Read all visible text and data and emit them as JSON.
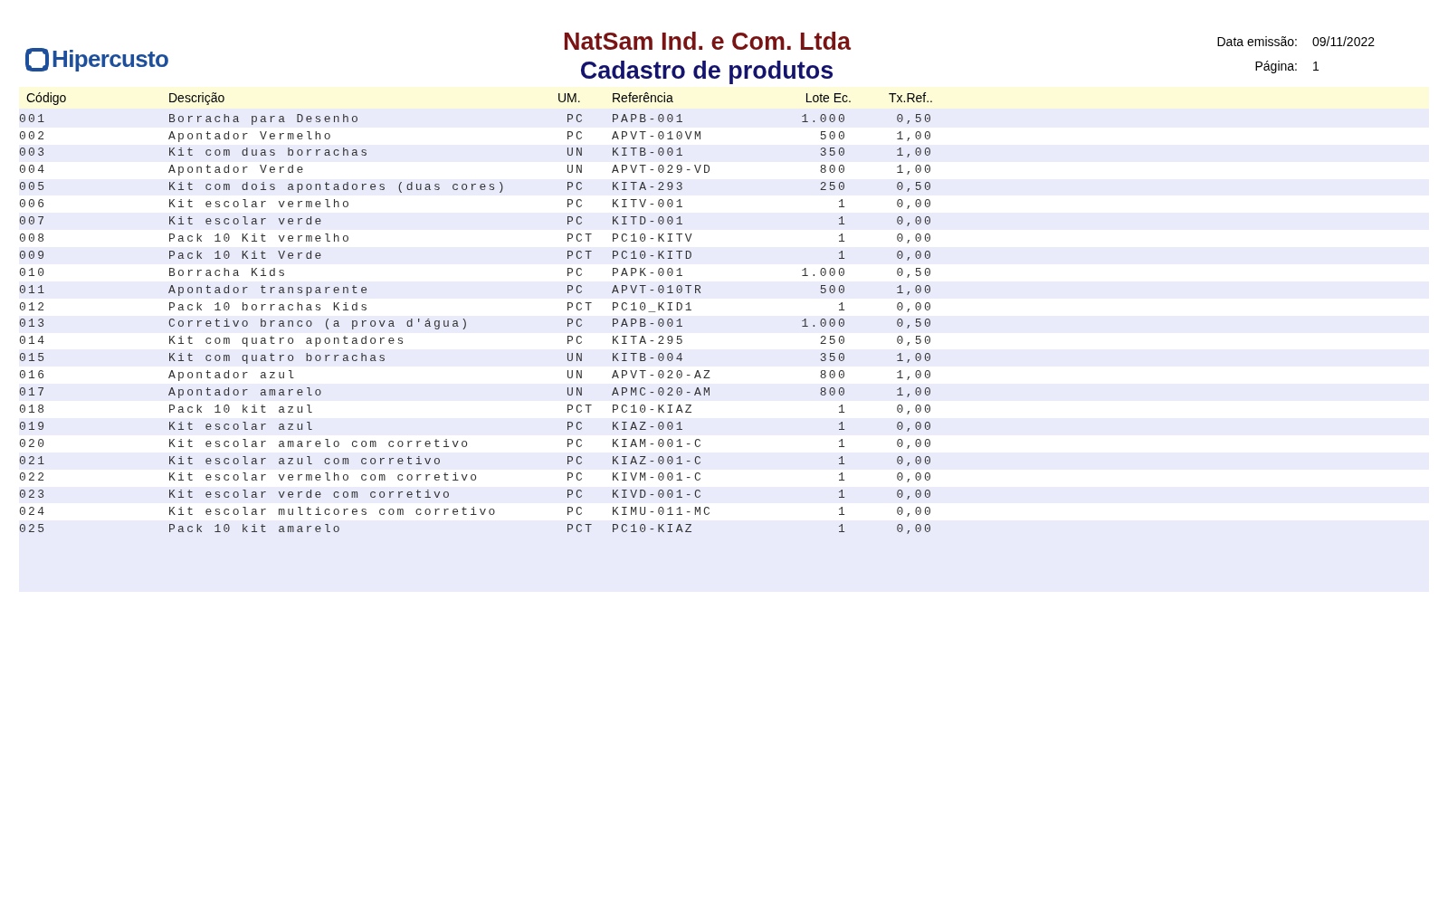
{
  "logo": {
    "text": "Hipercusto"
  },
  "header": {
    "company": "NatSam Ind. e Com. Ltda",
    "title": "Cadastro de produtos"
  },
  "meta": [
    {
      "label": "Data emissão:",
      "value": "09/11/2022"
    },
    {
      "label": "Página:",
      "value": "1"
    }
  ],
  "table": {
    "columns": [
      "Código",
      "Descrição",
      "UM.",
      "Referência",
      "Lote Ec.",
      "Tx.Ref.."
    ],
    "rows": [
      [
        "001",
        "Borracha para Desenho",
        "PC",
        "PAPB-001",
        "1.000",
        "0,50"
      ],
      [
        "002",
        "Apontador Vermelho",
        "PC",
        "APVT-010VM",
        "500",
        "1,00"
      ],
      [
        "003",
        "Kit com duas borrachas",
        "UN",
        "KITB-001",
        "350",
        "1,00"
      ],
      [
        "004",
        "Apontador Verde",
        "UN",
        "APVT-029-VD",
        "800",
        "1,00"
      ],
      [
        "005",
        "Kit com dois apontadores (duas cores)",
        "PC",
        "KITA-293",
        "250",
        "0,50"
      ],
      [
        "006",
        "Kit escolar vermelho",
        "PC",
        "KITV-001",
        "1",
        "0,00"
      ],
      [
        "007",
        "Kit escolar verde",
        "PC",
        "KITD-001",
        "1",
        "0,00"
      ],
      [
        "008",
        "Pack 10 Kit vermelho",
        "PCT",
        "PC10-KITV",
        "1",
        "0,00"
      ],
      [
        "009",
        "Pack 10 Kit Verde",
        "PCT",
        "PC10-KITD",
        "1",
        "0,00"
      ],
      [
        "010",
        "Borracha Kids",
        "PC",
        "PAPK-001",
        "1.000",
        "0,50"
      ],
      [
        "011",
        "Apontador transparente",
        "PC",
        "APVT-010TR",
        "500",
        "1,00"
      ],
      [
        "012",
        "Pack 10 borrachas Kids",
        "PCT",
        "PC10_KID1",
        "1",
        "0,00"
      ],
      [
        "013",
        "Corretivo branco (a prova d'água)",
        "PC",
        "PAPB-001",
        "1.000",
        "0,50"
      ],
      [
        "014",
        "Kit com quatro apontadores",
        "PC",
        "KITA-295",
        "250",
        "0,50"
      ],
      [
        "015",
        "Kit com quatro borrachas",
        "UN",
        "KITB-004",
        "350",
        "1,00"
      ],
      [
        "016",
        "Apontador azul",
        "UN",
        "APVT-020-AZ",
        "800",
        "1,00"
      ],
      [
        "017",
        "Apontador amarelo",
        "UN",
        "APMC-020-AM",
        "800",
        "1,00"
      ],
      [
        "018",
        "Pack 10 kit azul",
        "PCT",
        "PC10-KIAZ",
        "1",
        "0,00"
      ],
      [
        "019",
        "Kit escolar azul",
        "PC",
        "KIAZ-001",
        "1",
        "0,00"
      ],
      [
        "020",
        "Kit escolar amarelo com corretivo",
        "PC",
        "KIAM-001-C",
        "1",
        "0,00"
      ],
      [
        "021",
        "Kit escolar azul com corretivo",
        "PC",
        "KIAZ-001-C",
        "1",
        "0,00"
      ],
      [
        "022",
        "Kit escolar vermelho com corretivo",
        "PC",
        "KIVM-001-C",
        "1",
        "0,00"
      ],
      [
        "023",
        "Kit escolar verde com corretivo",
        "PC",
        "KIVD-001-C",
        "1",
        "0,00"
      ],
      [
        "024",
        "Kit escolar multicores com corretivo",
        "PC",
        "KIMU-011-MC",
        "1",
        "0,00"
      ],
      [
        "025",
        "Pack 10 kit amarelo",
        "PCT",
        "PC10-KIAZ",
        "1",
        "0,00"
      ]
    ]
  }
}
